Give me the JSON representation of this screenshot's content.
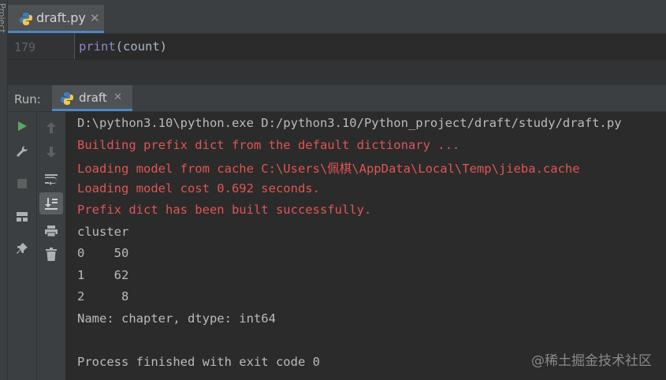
{
  "sidebar": {
    "project_label": "Project"
  },
  "editor": {
    "tab": {
      "label": "draft.py"
    },
    "line_number": "179",
    "code": {
      "fn": "print",
      "rest": "(count)"
    }
  },
  "run": {
    "label": "Run:",
    "tab_label": "draft"
  },
  "console": {
    "lines": [
      "D:\\python3.10\\python.exe D:/python3.10/Python_project/draft/study/draft.py",
      "Building prefix dict from the default dictionary ...",
      "Loading model from cache C:\\Users\\佩棋\\AppData\\Local\\Temp\\jieba.cache",
      "Loading model cost 0.692 seconds.",
      "Prefix dict has been built successfully.",
      "cluster",
      "0    50",
      "1    62",
      "2     8",
      "Name: chapter, dtype: int64",
      "",
      "Process finished with exit code 0"
    ]
  },
  "watermark": "@稀土掘金技术社区",
  "colors": {
    "accent": "#4a88c7",
    "error_text": "#e05555",
    "run_green": "#59a869"
  },
  "icons": {
    "toolbar_left": [
      "run-icon",
      "wrench-icon",
      "stop-icon",
      "layout-icon",
      "pin-icon"
    ],
    "toolbar_right": [
      "arrow-up-icon",
      "arrow-down-icon",
      "soft-wrap-icon",
      "scroll-to-end-icon",
      "print-icon",
      "trash-icon"
    ]
  }
}
